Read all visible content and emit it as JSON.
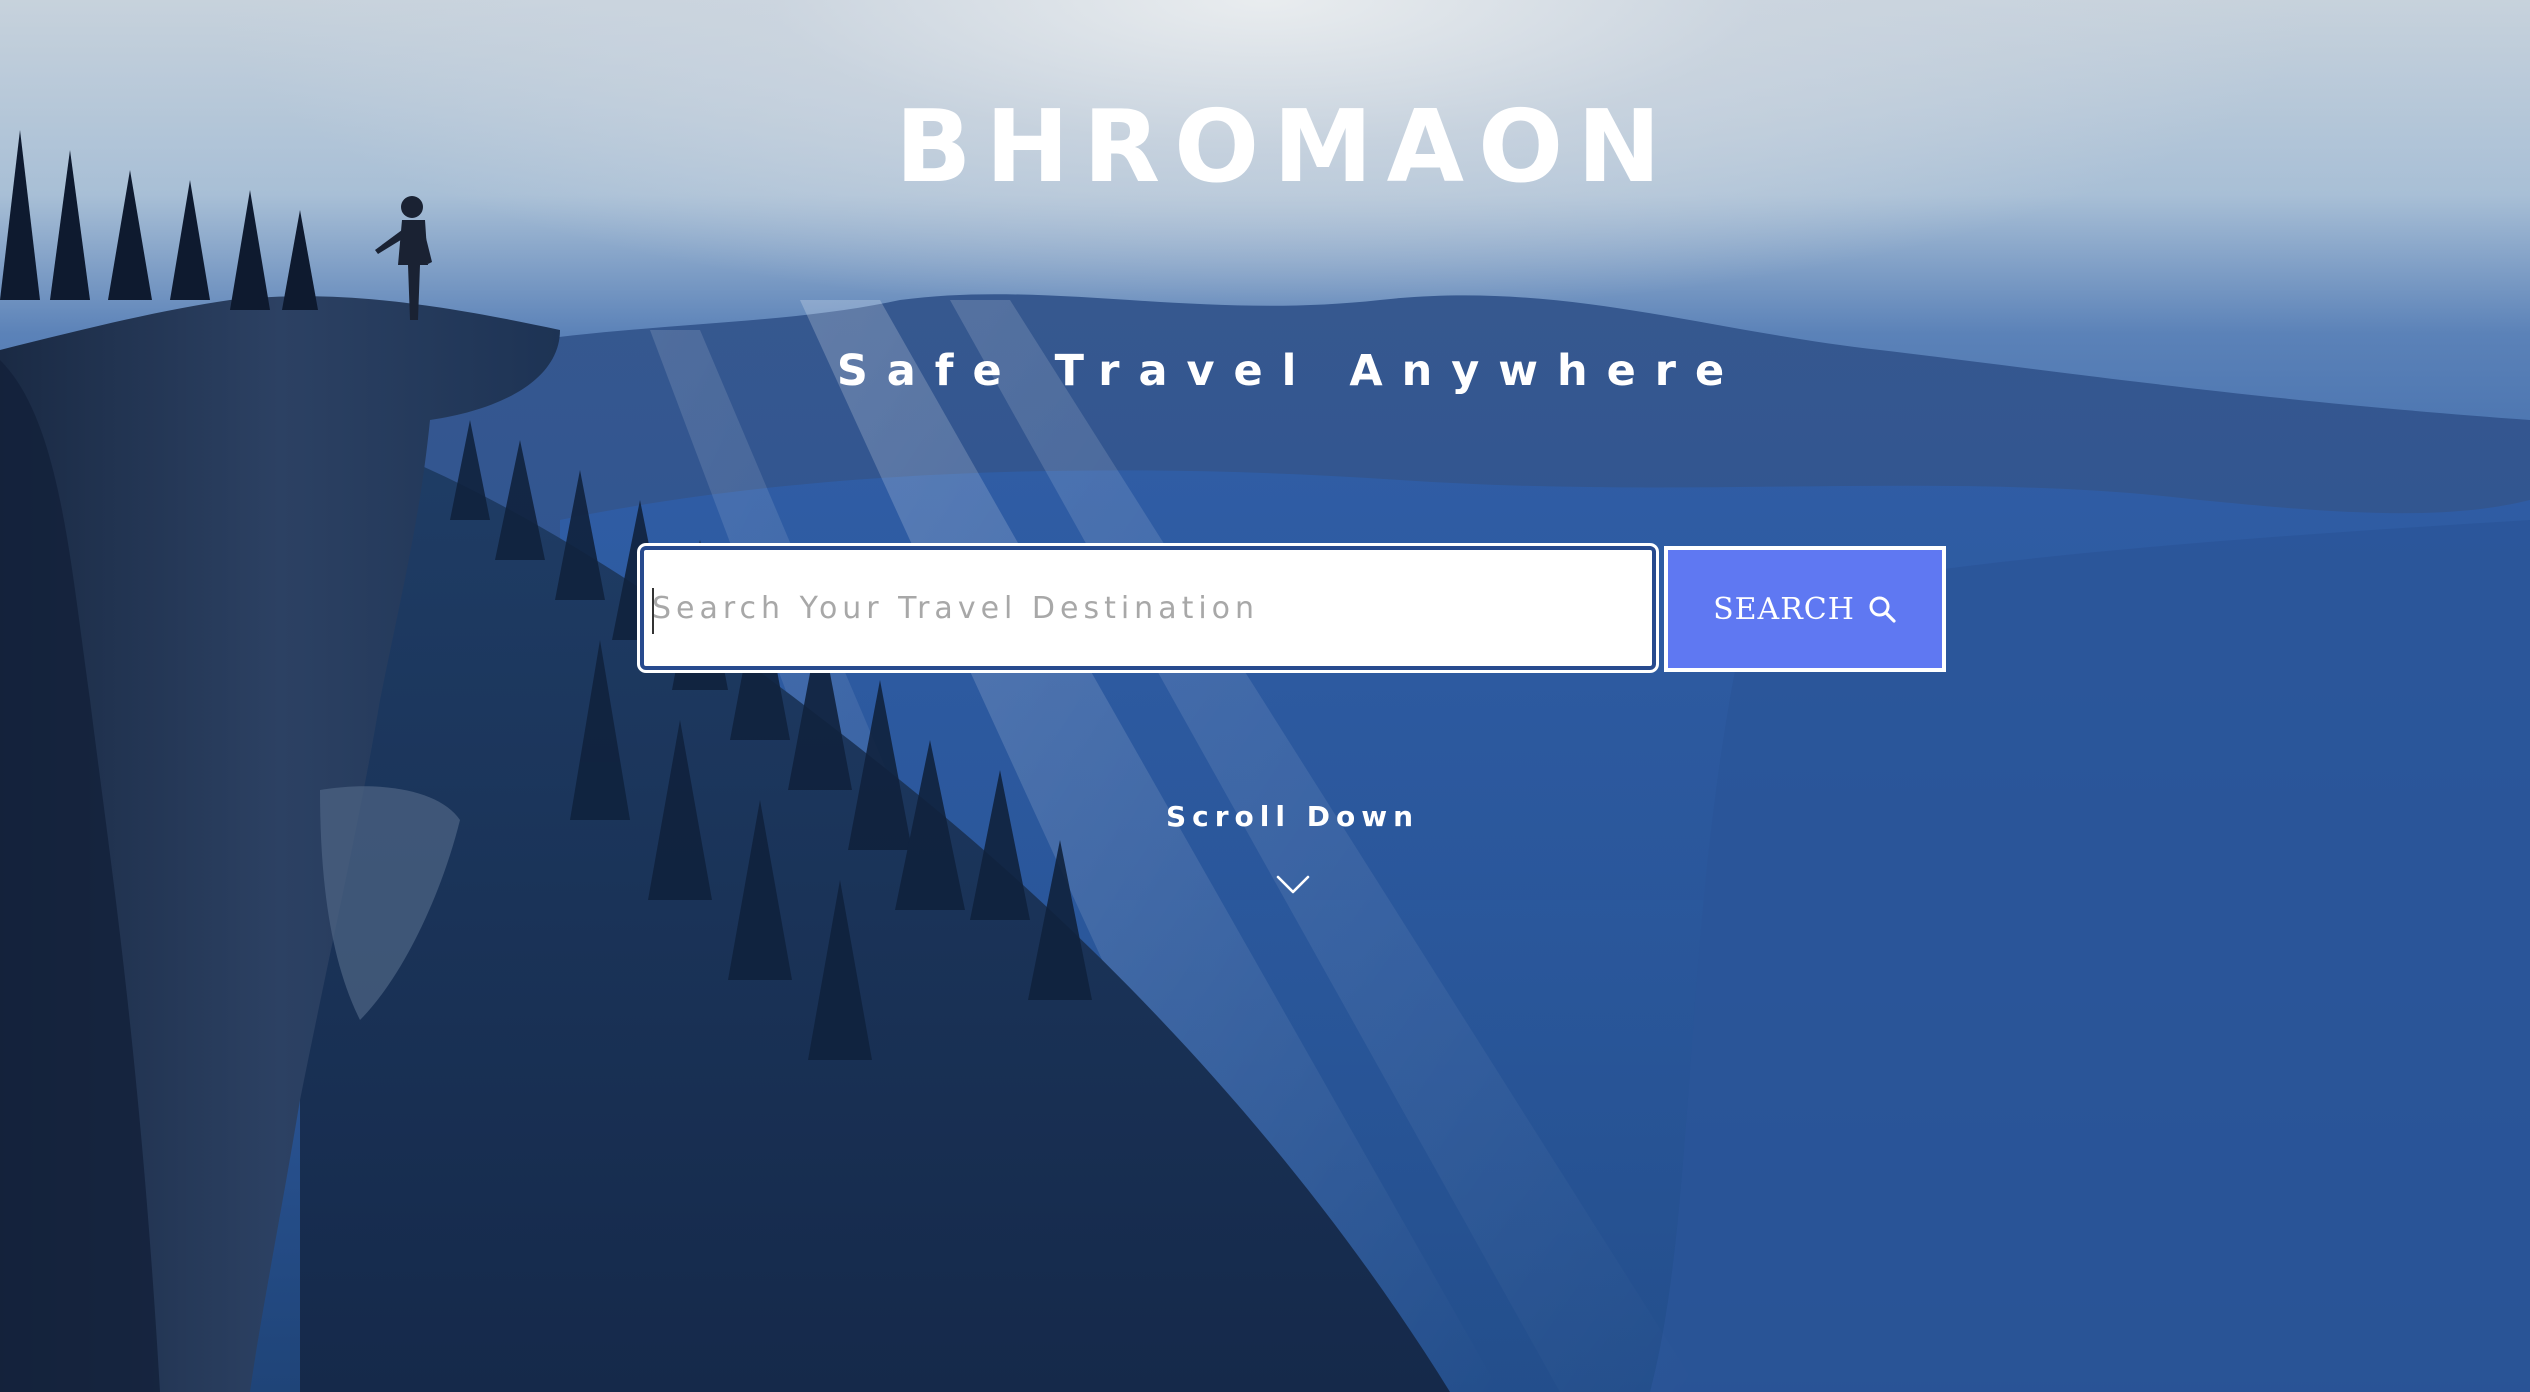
{
  "hero": {
    "brand": "BHROMAON",
    "tagline": "Safe Travel Anywhere",
    "background_image": "mountain-valley-photo",
    "colors": {
      "accent_button": "#5f78f2",
      "input_border": "#274a8e",
      "text": "#ffffff"
    }
  },
  "search": {
    "placeholder": "Search Your Travel Destination",
    "value": "",
    "button_label": "SEARCH",
    "button_icon": "search-icon"
  },
  "scroll": {
    "label": "Scroll Down",
    "icon": "chevron-down-icon"
  }
}
